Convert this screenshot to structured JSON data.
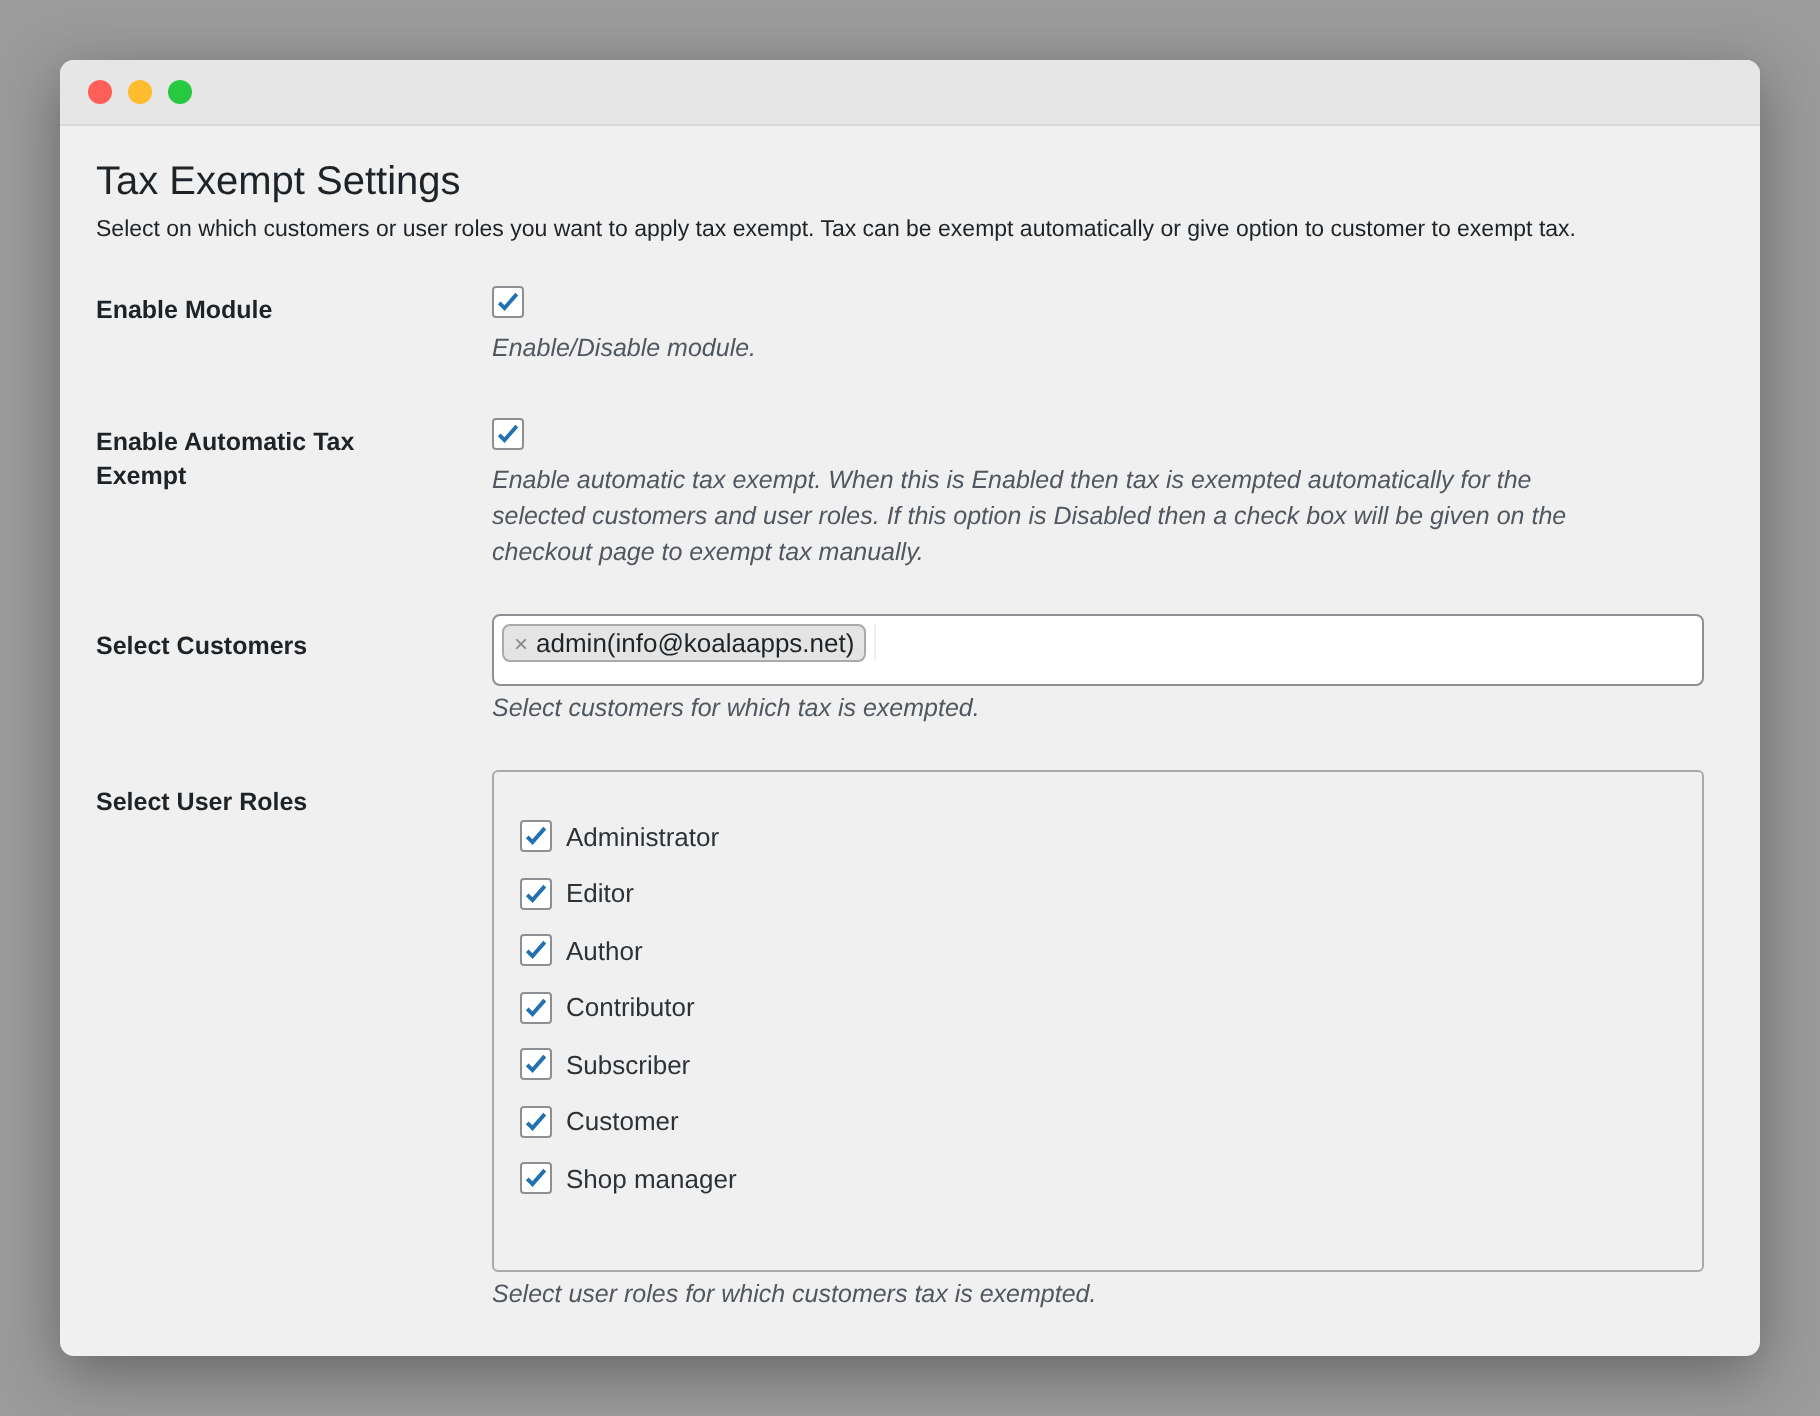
{
  "title": "Tax Exempt Settings",
  "intro": "Select on which customers or user roles you want to apply tax exempt. Tax can be exempt automatically or give option to customer to exempt tax.",
  "settings": [
    {
      "kind": "checkbox",
      "label": "Enable Module",
      "checked": true,
      "description": "Enable/Disable module."
    },
    {
      "kind": "checkbox",
      "label": "Enable Automatic Tax Exempt",
      "checked": true,
      "description": "Enable automatic tax exempt. When this is Enabled then tax is exempted automatically for the selected customers and user roles. If this option is Disabled then a check box will be given on the checkout page to exempt tax manually."
    },
    {
      "kind": "tokens",
      "label": "Select Customers",
      "tokens": [
        {
          "remove": "×",
          "text": "admin(info@koalaapps.net)"
        }
      ],
      "description": "Select customers for which tax is exempted."
    },
    {
      "kind": "checklist",
      "label": "Select User Roles",
      "options": [
        {
          "label": "Administrator",
          "checked": true
        },
        {
          "label": "Editor",
          "checked": true
        },
        {
          "label": "Author",
          "checked": true
        },
        {
          "label": "Contributor",
          "checked": true
        },
        {
          "label": "Subscriber",
          "checked": true
        },
        {
          "label": "Customer",
          "checked": true
        },
        {
          "label": "Shop manager",
          "checked": true
        }
      ],
      "description": "Select user roles for which customers tax is exempted."
    }
  ]
}
